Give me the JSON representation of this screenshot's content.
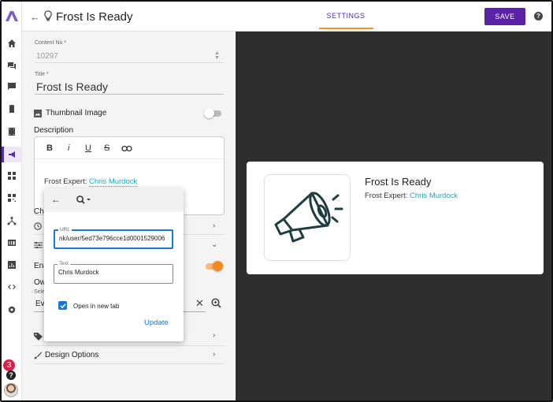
{
  "header": {
    "title": "Frost Is Ready",
    "tab_settings": "SETTINGS",
    "save_label": "SAVE",
    "help": "?"
  },
  "rail": {
    "notification_count": "3",
    "help": "?"
  },
  "form": {
    "content_no_label": "Content No",
    "content_no_value": "10297",
    "title_label": "Title",
    "title_value": "Frost Is Ready",
    "thumbnail_label": "Thumbnail Image",
    "description_label": "Description",
    "editor_toolbar": {
      "bold": "B",
      "italic": "i",
      "underline": "U",
      "strike": "S"
    },
    "description_prefix": "Frost Expert: ",
    "description_link": "Chris Murdock",
    "partial_ch": "Ch",
    "partial_ena": "Ena",
    "partial_ow": "Ow",
    "partial_sel": "Sele",
    "partial_ev": "Ev",
    "design_options": "Design Options"
  },
  "link_popup": {
    "url_label": "URL",
    "url_value": "nk/user/5ed73e796cce1d0001529006",
    "text_label": "Text",
    "text_value": "Chris Murdock",
    "new_tab_label": "Open in new tab",
    "update_label": "Update"
  },
  "preview": {
    "title": "Frost Is Ready",
    "subtitle_prefix": "Frost Expert: ",
    "subtitle_link": "Chris Murdock"
  },
  "colors": {
    "accent": "#5a23a6",
    "orange": "#f28a1e",
    "link": "#1aa6c7",
    "preview_bg": "#2e2e2e"
  }
}
